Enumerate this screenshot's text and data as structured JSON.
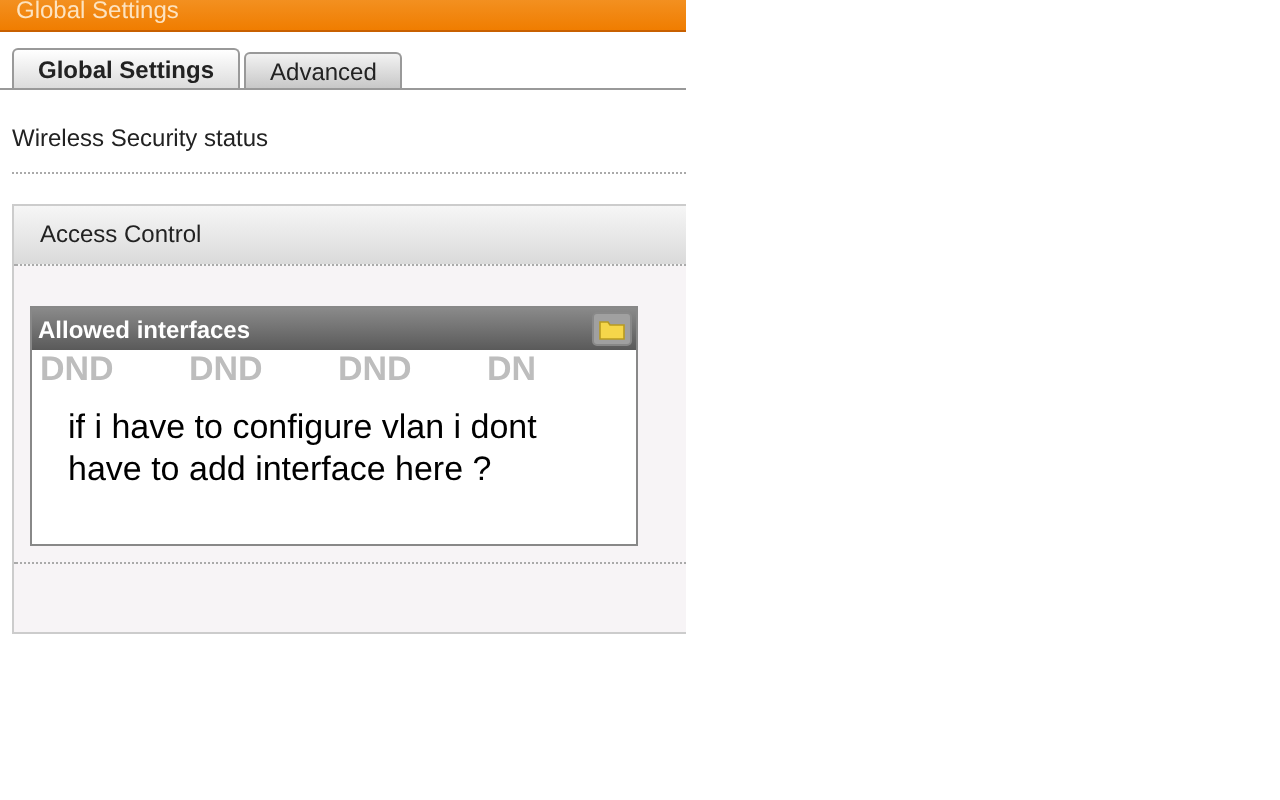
{
  "header": {
    "title": "Global Settings"
  },
  "tabs": [
    {
      "label": "Global Settings",
      "selected": true
    },
    {
      "label": "Advanced",
      "selected": false
    }
  ],
  "status_label": "Wireless Security status",
  "panel": {
    "title": "Access Control",
    "list": {
      "title": "Allowed interfaces",
      "placeholder_marks": [
        "DND",
        "DND",
        "DND",
        "DN"
      ],
      "note": "if i have to configure vlan i dont have to add interface here ?"
    }
  }
}
